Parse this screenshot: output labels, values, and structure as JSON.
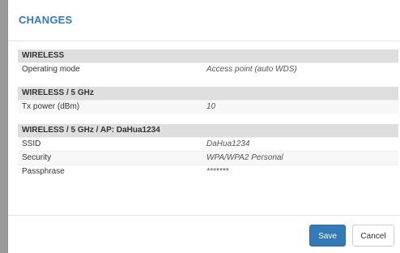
{
  "modal": {
    "title": "CHANGES"
  },
  "sections": [
    {
      "header": "WIRELESS",
      "rows": [
        {
          "key": "Operating mode",
          "value": "Access point (auto WDS)"
        }
      ]
    },
    {
      "header": "WIRELESS / 5 GHz",
      "rows": [
        {
          "key": "Tx power (dBm)",
          "value": "10"
        }
      ]
    },
    {
      "header": "WIRELESS / 5 GHz / AP: DaHua1234",
      "rows": [
        {
          "key": "SSID",
          "value": "DaHua1234"
        },
        {
          "key": "Security",
          "value": "WPA/WPA2 Personal"
        },
        {
          "key": "Passphrase",
          "value": "*******"
        }
      ]
    }
  ],
  "footer": {
    "save_label": "Save",
    "cancel_label": "Cancel"
  },
  "colors": {
    "accent": "#337ab7",
    "section_header_bg": "#dedede"
  }
}
